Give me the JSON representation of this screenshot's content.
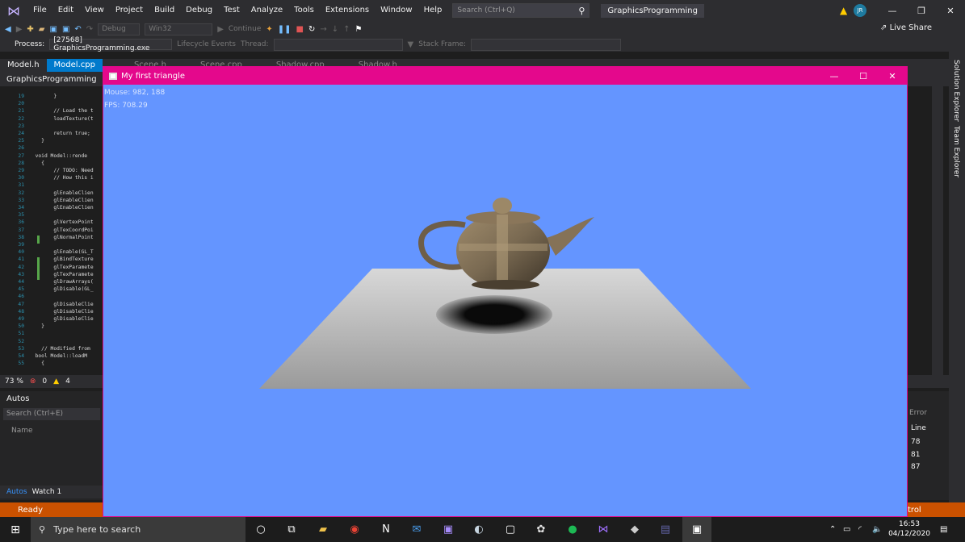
{
  "menubar": {
    "items": [
      "File",
      "Edit",
      "View",
      "Project",
      "Build",
      "Debug",
      "Test",
      "Analyze",
      "Tools",
      "Extensions",
      "Window",
      "Help"
    ],
    "search_placeholder": "Search (Ctrl+Q)",
    "solution_name": "GraphicsProgramming",
    "avatar_initials": "JR"
  },
  "toolbar": {
    "config": "Debug",
    "platform": "Win32",
    "continue_label": "Continue",
    "live_share": "Live Share",
    "process_label": "Process:",
    "process_value": "[27568] GraphicsProgramming.exe",
    "lifecycle": "Lifecycle Events",
    "thread_label": "Thread:",
    "stack_frame_label": "Stack Frame:"
  },
  "tabs": [
    {
      "label": "Model.h",
      "state": "normal"
    },
    {
      "label": "Model.cpp",
      "state": "active"
    },
    {
      "label": "Scene.h",
      "state": "faded"
    },
    {
      "label": "Scene.cpp",
      "state": "faded"
    },
    {
      "label": "Shadow.cpp",
      "state": "faded"
    },
    {
      "label": "Shadow.h",
      "state": "faded"
    }
  ],
  "navbar": {
    "project": "GraphicsProgramming"
  },
  "code_lines": [
    {
      "n": "19",
      "t": "        }"
    },
    {
      "n": "20",
      "t": ""
    },
    {
      "n": "21",
      "t": "        // Load the t"
    },
    {
      "n": "22",
      "t": "        loadTexture(t"
    },
    {
      "n": "23",
      "t": ""
    },
    {
      "n": "24",
      "t": "        return true;"
    },
    {
      "n": "25",
      "t": "    }"
    },
    {
      "n": "26",
      "t": ""
    },
    {
      "n": "27",
      "t": "  void Model::rende"
    },
    {
      "n": "28",
      "t": "    {"
    },
    {
      "n": "29",
      "t": "        // TODO: Need"
    },
    {
      "n": "30",
      "t": "        // How this i"
    },
    {
      "n": "31",
      "t": ""
    },
    {
      "n": "32",
      "t": "        glEnableClien"
    },
    {
      "n": "33",
      "t": "        glEnableClien"
    },
    {
      "n": "34",
      "t": "        glEnableClien"
    },
    {
      "n": "35",
      "t": ""
    },
    {
      "n": "36",
      "t": "        glVertexPoint"
    },
    {
      "n": "37",
      "t": "        glTexCoordPoi"
    },
    {
      "n": "38",
      "t": "        glNormalPoint"
    },
    {
      "n": "39",
      "t": ""
    },
    {
      "n": "40",
      "t": "        glEnable(GL_T"
    },
    {
      "n": "41",
      "t": "        glBindTexture"
    },
    {
      "n": "42",
      "t": "        glTexParamete"
    },
    {
      "n": "43",
      "t": "        glTexParamete"
    },
    {
      "n": "44",
      "t": "        glDrawArrays("
    },
    {
      "n": "45",
      "t": "        glDisable(GL_"
    },
    {
      "n": "46",
      "t": ""
    },
    {
      "n": "47",
      "t": "        glDisableClie"
    },
    {
      "n": "48",
      "t": "        glDisableClie"
    },
    {
      "n": "49",
      "t": "        glDisableClie"
    },
    {
      "n": "50",
      "t": "    }"
    },
    {
      "n": "51",
      "t": ""
    },
    {
      "n": "52",
      "t": ""
    },
    {
      "n": "53",
      "t": "    // Modified from"
    },
    {
      "n": "54",
      "t": "  bool Model::loadM"
    },
    {
      "n": "55",
      "t": "    {"
    }
  ],
  "editor_status": {
    "zoom": "73 %",
    "errors": "0",
    "warnings": "4"
  },
  "side_panels": [
    "Solution Explorer",
    "Team Explorer"
  ],
  "autos": {
    "title": "Autos",
    "search_placeholder": "Search (Ctrl+E)",
    "column": "Name",
    "tabs": [
      "Autos",
      "Watch 1"
    ]
  },
  "right_panel": {
    "header_text": "Error",
    "column": "Line",
    "lines": [
      "78",
      "81",
      "87"
    ]
  },
  "status_bar": {
    "text": "Ready",
    "right_text": "trol"
  },
  "gl_window": {
    "title": "My first triangle",
    "mouse": "Mouse: 982, 188",
    "fps": "FPS: 708.29",
    "colors": {
      "background": "#6495ff",
      "titlebar": "#e4088c",
      "floor": "#b0b0b0"
    }
  },
  "taskbar": {
    "search_placeholder": "Type here to search",
    "apps": [
      "cortana-icon",
      "task-view-icon",
      "file-explorer-icon",
      "chrome-icon",
      "notion-icon",
      "mail-icon",
      "photos-icon",
      "steam-icon",
      "twitch-icon",
      "davinci-icon",
      "spotify-icon",
      "visual-studio-icon",
      "app-icon",
      "teams-icon",
      "gl-window-icon"
    ],
    "clock_time": "16:53",
    "clock_date": "04/12/2020"
  }
}
